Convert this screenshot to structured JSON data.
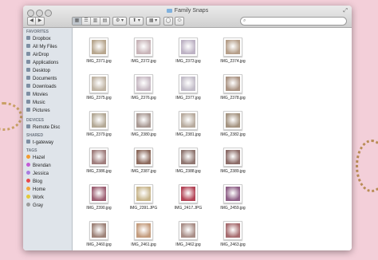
{
  "window": {
    "title": "Family Snaps"
  },
  "toolbar": {
    "back_label": "◀",
    "forward_label": "▶",
    "views": [
      "▦",
      "☰",
      "▥",
      "▤"
    ],
    "action_label": "⚙ ▾",
    "share_label": "⬆ ▾",
    "arrange_label": "▦ ▾",
    "path_label": "◯",
    "tag_label": "⬭",
    "search_placeholder": "",
    "search_icon": "search-icon"
  },
  "sidebar": {
    "sections": [
      {
        "title": "FAVORITES",
        "items": [
          {
            "label": "Dropbox",
            "icon": "dropbox-icon"
          },
          {
            "label": "All My Files",
            "icon": "all-files-icon"
          },
          {
            "label": "AirDrop",
            "icon": "airdrop-icon"
          },
          {
            "label": "Applications",
            "icon": "applications-icon"
          },
          {
            "label": "Desktop",
            "icon": "desktop-icon"
          },
          {
            "label": "Documents",
            "icon": "documents-icon"
          },
          {
            "label": "Downloads",
            "icon": "downloads-icon"
          },
          {
            "label": "Movies",
            "icon": "movies-icon"
          },
          {
            "label": "Music",
            "icon": "music-icon"
          },
          {
            "label": "Pictures",
            "icon": "pictures-icon"
          }
        ]
      },
      {
        "title": "DEVICES",
        "items": [
          {
            "label": "Remote Disc",
            "icon": "disc-icon"
          }
        ]
      },
      {
        "title": "SHARED",
        "items": [
          {
            "label": "t-gateway",
            "icon": "network-icon"
          }
        ]
      },
      {
        "title": "TAGS",
        "items": [
          {
            "label": "Hazel",
            "color": "#f39a31"
          },
          {
            "label": "Brendan",
            "color": "#c35ad6"
          },
          {
            "label": "Jessica",
            "color": "#a97be0"
          },
          {
            "label": "Blog",
            "color": "#e9474b"
          },
          {
            "label": "Home",
            "color": "#f3a639"
          },
          {
            "label": "Work",
            "color": "#e3c93a"
          },
          {
            "label": "Gray",
            "color": "#9c9c9c"
          }
        ]
      }
    ]
  },
  "files": [
    {
      "name": "IMG_2371.jpg",
      "tone": "#b7a68e"
    },
    {
      "name": "IMG_2372.jpg",
      "tone": "#c8b4b8"
    },
    {
      "name": "IMG_2373.jpg",
      "tone": "#bdb2c4"
    },
    {
      "name": "IMG_2374.jpg",
      "tone": "#b59e89"
    },
    {
      "name": "IMG_2375.jpg",
      "tone": "#bfb3a3"
    },
    {
      "name": "IMG_2376.jpg",
      "tone": "#c6b8c2"
    },
    {
      "name": "IMG_2377.jpg",
      "tone": "#c2bcc8"
    },
    {
      "name": "IMG_2378.jpg",
      "tone": "#aa9383"
    },
    {
      "name": "IMG_2379.jpg",
      "tone": "#b3a895"
    },
    {
      "name": "IMG_2380.jpg",
      "tone": "#a89892"
    },
    {
      "name": "IMG_2381.jpg",
      "tone": "#b7aa9d"
    },
    {
      "name": "IMG_2382.jpg",
      "tone": "#a49380"
    },
    {
      "name": "IMG_2386.jpg",
      "tone": "#9f7d7c"
    },
    {
      "name": "IMG_2387.jpg",
      "tone": "#8c6a5d"
    },
    {
      "name": "IMG_2388.jpg",
      "tone": "#8f7670"
    },
    {
      "name": "IMG_2389.jpg",
      "tone": "#8b6b67"
    },
    {
      "name": "IMG_2390.jpg",
      "tone": "#9c5f72"
    },
    {
      "name": "IMG_2391.JPG",
      "tone": "#c7b48a"
    },
    {
      "name": "IMG_2417.JPG",
      "tone": "#b24355"
    },
    {
      "name": "IMG_2459.jpg",
      "tone": "#8e5f86"
    },
    {
      "name": "IMG_2460.jpg",
      "tone": "#9d8278"
    },
    {
      "name": "IMG_2461.jpg",
      "tone": "#c39b7c"
    },
    {
      "name": "IMG_2462.jpg",
      "tone": "#a88d86"
    },
    {
      "name": "IMG_2463.jpg",
      "tone": "#a66b6e"
    }
  ]
}
